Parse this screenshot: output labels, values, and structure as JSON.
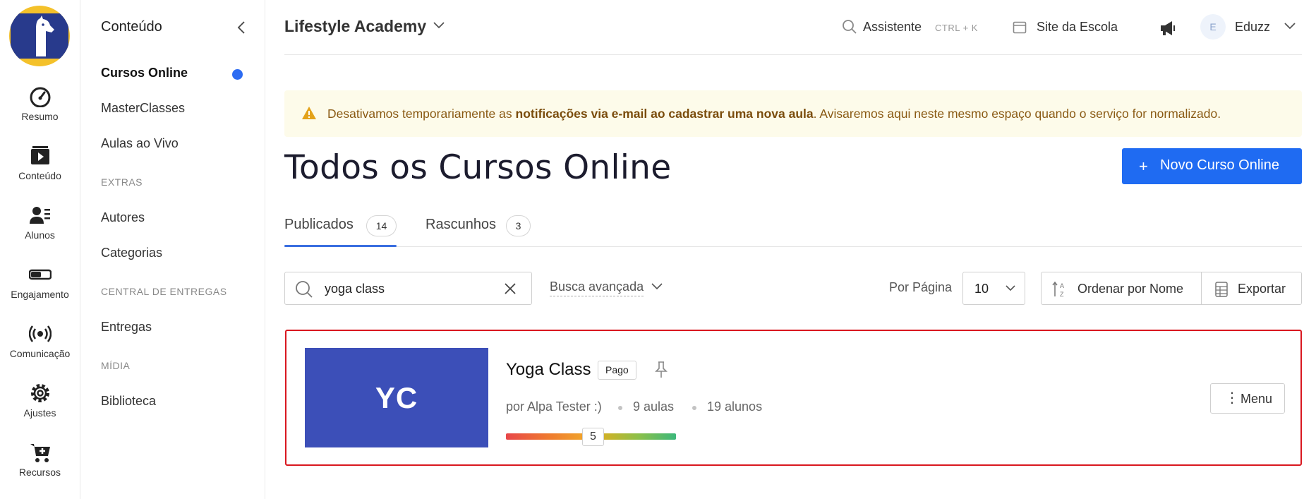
{
  "rail": {
    "items": [
      {
        "label": "Resumo",
        "icon": "speedometer-icon"
      },
      {
        "label": "Conteúdo",
        "icon": "video-icon"
      },
      {
        "label": "Alunos",
        "icon": "users-icon"
      },
      {
        "label": "Engajamento",
        "icon": "toggle-icon"
      },
      {
        "label": "Comunicação",
        "icon": "broadcast-icon"
      },
      {
        "label": "Ajustes",
        "icon": "gear-icon"
      },
      {
        "label": "Recursos",
        "icon": "cart-plus-icon"
      }
    ]
  },
  "sidebar": {
    "title": "Conteúdo",
    "items": {
      "cursos_online": "Cursos Online",
      "masterclasses": "MasterClasses",
      "aulas_ao_vivo": "Aulas ao Vivo",
      "extras": "EXTRAS",
      "autores": "Autores",
      "categorias": "Categorias",
      "central": "CENTRAL DE ENTREGAS",
      "entregas": "Entregas",
      "midia": "MÍDIA",
      "biblioteca": "Biblioteca"
    }
  },
  "header": {
    "school_name": "Lifestyle Academy",
    "assistant": "Assistente",
    "assistant_shortcut": "CTRL + K",
    "site": "Site da Escola",
    "avatar_initial": "E",
    "user": "Eduzz"
  },
  "alert": {
    "before": "Desativamos temporariamente as ",
    "bold": "notificações via e-mail ao cadastrar uma nova aula",
    "after": ". Avisaremos aqui neste mesmo espaço quando o serviço for normalizado."
  },
  "page": {
    "title": "Todos os Cursos Online",
    "new_button": "Novo Curso Online"
  },
  "tabs": {
    "published": {
      "label": "Publicados",
      "count": "14"
    },
    "drafts": {
      "label": "Rascunhos",
      "count": "3"
    }
  },
  "filters": {
    "search_value": "yoga class",
    "advanced": "Busca avançada",
    "per_page_label": "Por Página",
    "per_page_value": "10",
    "sort": "Ordenar por Nome",
    "export": "Exportar"
  },
  "course": {
    "initials": "YC",
    "name": "Yoga Class",
    "badge": "Pago",
    "author": "por Alpa Tester :)",
    "lessons": "9 aulas",
    "students": "19 alunos",
    "score": "5",
    "menu": "Menu"
  },
  "colors": {
    "accent": "#1f6bf2",
    "thumbnail": "#3c4fb8",
    "highlight_border": "#d9171f",
    "alert_bg": "#fdfbea"
  }
}
